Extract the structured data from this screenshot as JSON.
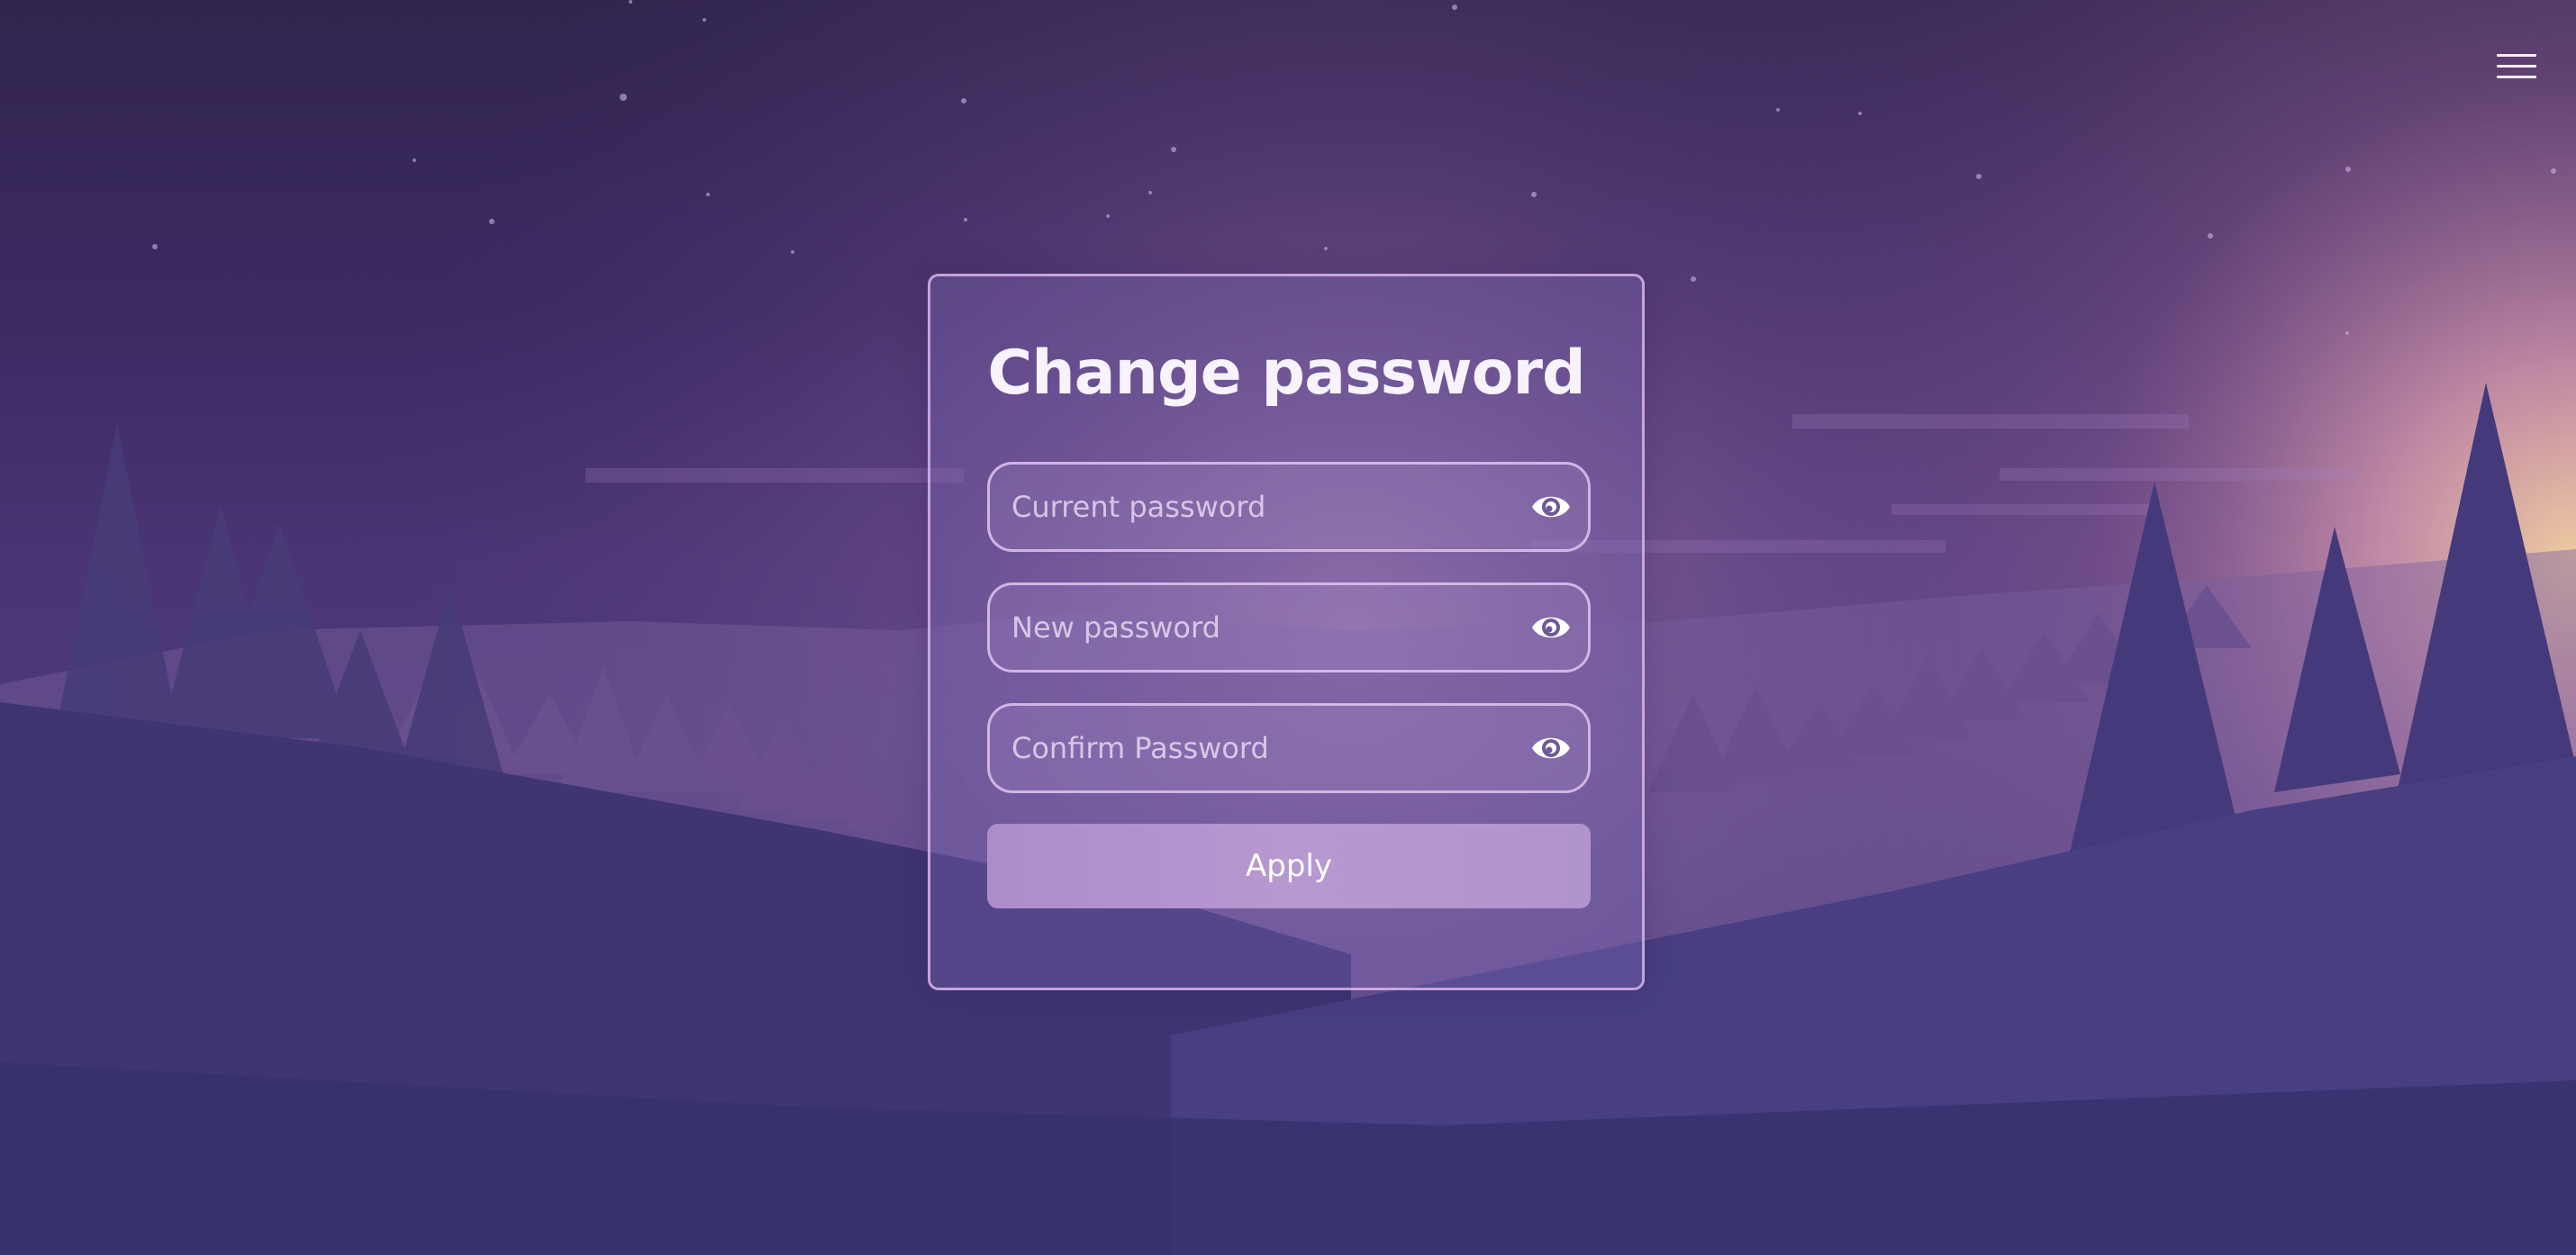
{
  "form": {
    "title": "Change password",
    "fields": [
      {
        "placeholder": "Current password",
        "value": "",
        "toggle_icon": "eye-icon"
      },
      {
        "placeholder": "New password",
        "value": "",
        "toggle_icon": "eye-icon"
      },
      {
        "placeholder": "Confirm Password",
        "value": "",
        "toggle_icon": "eye-icon"
      }
    ],
    "apply_label": "Apply"
  },
  "header": {
    "menu_icon": "hamburger-menu-icon"
  },
  "colors": {
    "accent": "#b498cf",
    "card_border": "#d7b4eb",
    "background_top": "#32254f",
    "background_bottom": "#33306b",
    "glow": "#f3c0a6"
  }
}
